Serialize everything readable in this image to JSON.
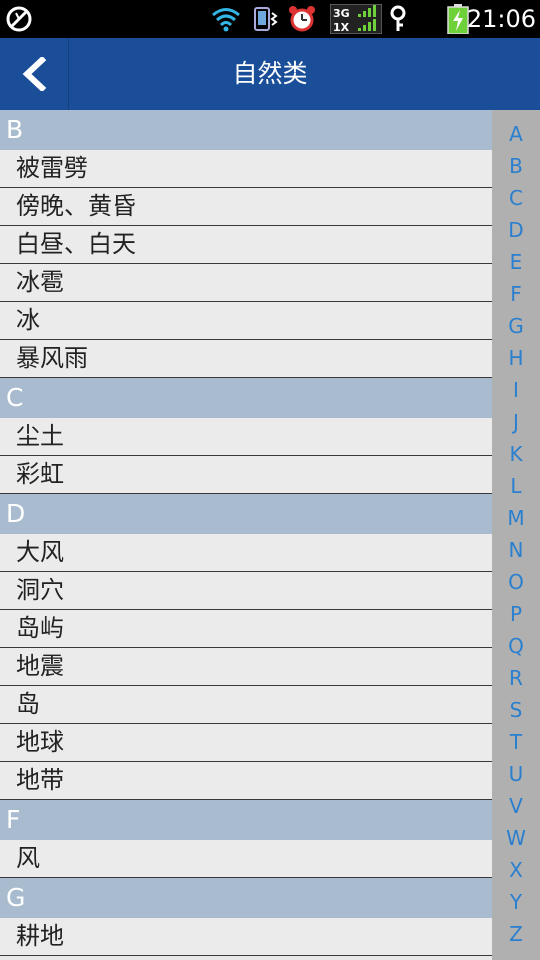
{
  "status_bar": {
    "time": "21:06",
    "icons": [
      "blocked-icon",
      "wifi-icon",
      "vibrate-icon",
      "alarm-icon",
      "signal-3g-1x-icon",
      "key-icon",
      "battery-charging-icon"
    ],
    "network_label_top": "3G",
    "network_label_bottom": "1X"
  },
  "header": {
    "title": "自然类",
    "back_icon": "chevron-left-icon"
  },
  "sections": [
    {
      "letter": "B",
      "items": [
        "被雷劈",
        "傍晚、黄昏",
        "白昼、白天",
        "冰雹",
        "冰",
        "暴风雨"
      ]
    },
    {
      "letter": "C",
      "items": [
        "尘土",
        "彩虹"
      ]
    },
    {
      "letter": "D",
      "items": [
        "大风",
        "洞穴",
        "岛屿",
        "地震",
        "岛",
        "地球",
        "地带"
      ]
    },
    {
      "letter": "F",
      "items": [
        "风"
      ]
    },
    {
      "letter": "G",
      "items": [
        "耕地"
      ]
    }
  ],
  "index_letters": [
    "A",
    "B",
    "C",
    "D",
    "E",
    "F",
    "G",
    "H",
    "I",
    "J",
    "K",
    "L",
    "M",
    "N",
    "O",
    "P",
    "Q",
    "R",
    "S",
    "T",
    "U",
    "V",
    "W",
    "X",
    "Y",
    "Z"
  ],
  "colors": {
    "title_bar": "#1a4e99",
    "section_header": "#a9bccf",
    "index_letter": "#2a7fcf",
    "battery": "#6fd13a"
  }
}
